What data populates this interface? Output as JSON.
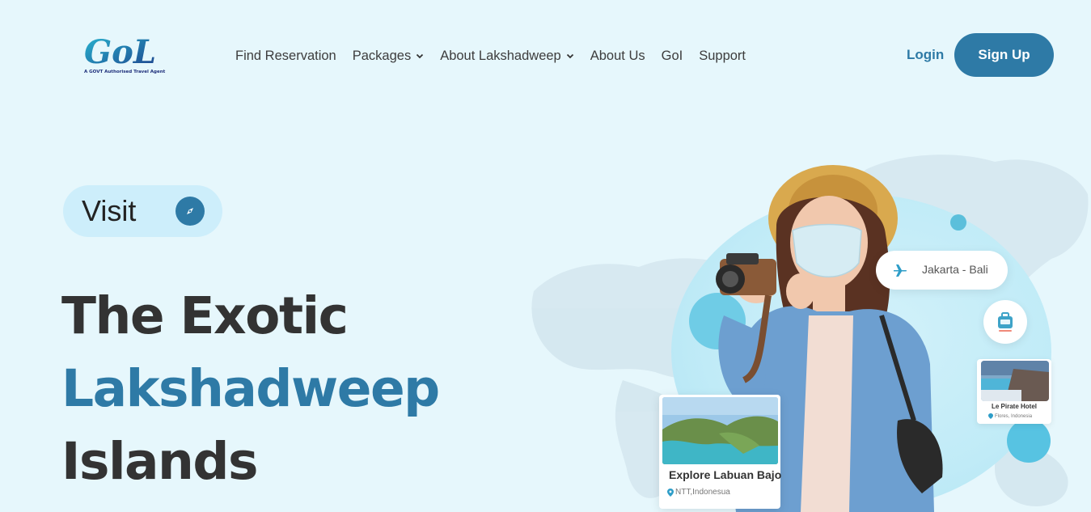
{
  "brand": {
    "logo_text": "GoL",
    "tagline": "A GOVT Authorised Travel Agent"
  },
  "nav": {
    "items": [
      {
        "label": "Find Reservation",
        "has_dropdown": false
      },
      {
        "label": "Packages",
        "has_dropdown": true
      },
      {
        "label": "About Lakshadweep",
        "has_dropdown": true
      },
      {
        "label": "About Us",
        "has_dropdown": false
      },
      {
        "label": "GoI",
        "has_dropdown": false
      },
      {
        "label": "Support",
        "has_dropdown": false
      }
    ],
    "login_label": "Login",
    "signup_label": "Sign Up"
  },
  "hero": {
    "pill_label": "Visit",
    "pill_icon": "compass-icon",
    "headline": {
      "line1": "The Exotic",
      "line2": "Lakshadweep",
      "line3": "Islands"
    },
    "route_chip": {
      "icon": "airplane-icon",
      "label": "Jakarta - Bali"
    },
    "bag_chip": {
      "icon": "luggage-icon"
    },
    "hotel_card": {
      "name": "Le Pirate Hotel",
      "location": "Flores, Indonesia"
    },
    "explore_card": {
      "title": "Explore Labuan Bajo",
      "location": "NTT,Indonesua"
    }
  },
  "colors": {
    "background": "#e6f7fc",
    "accent": "#2e7aa6",
    "pill_bg": "#cdeefb",
    "bubble": "#5bbfdb"
  }
}
